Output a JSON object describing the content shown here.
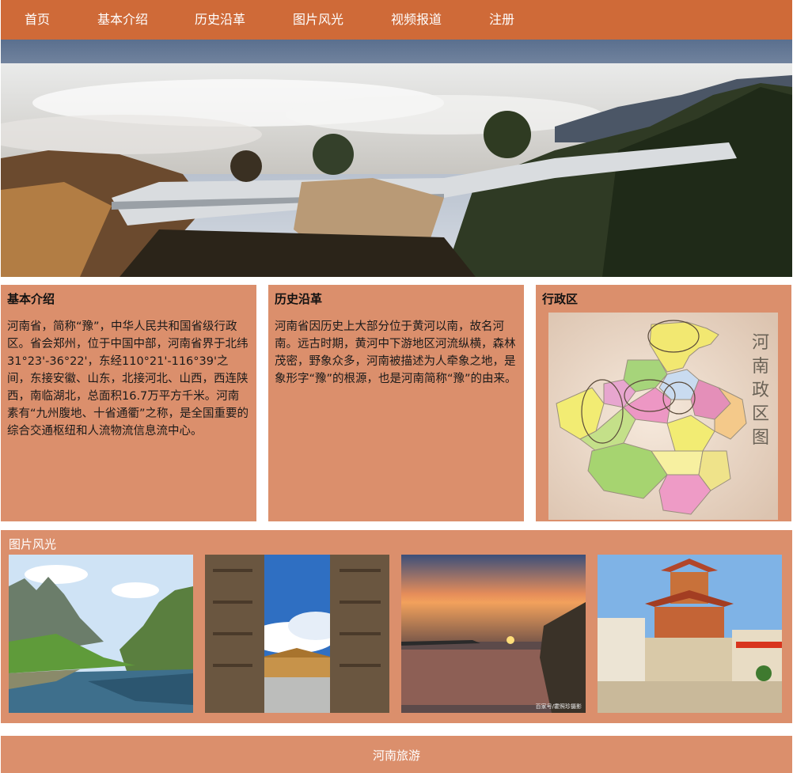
{
  "nav": {
    "items": [
      {
        "label": "首页"
      },
      {
        "label": "基本介绍"
      },
      {
        "label": "历史沿革"
      },
      {
        "label": "图片风光"
      },
      {
        "label": "视频报道"
      },
      {
        "label": "注册"
      }
    ]
  },
  "intro": {
    "title": "基本介绍",
    "text": "河南省，简称“豫”，中华人民共和国省级行政区。省会郑州，位于中国中部，河南省界于北纬31°23'-36°22'，东经110°21'-116°39'之间，东接安徽、山东，北接河北、山西，西连陕西，南临湖北，总面积16.7万平方千米。河南素有“九州腹地、十省通衢”之称，是全国重要的综合交通枢纽和人流物流信息流中心。"
  },
  "history": {
    "title": "历史沿革",
    "text": "河南省因历史上大部分位于黄河以南，故名河南。远古时期，黄河中下游地区河流纵横，森林茂密，野象众多，河南被描述为人牵象之地，是象形字“豫”的根源，也是河南简称“豫”的由来。"
  },
  "admin": {
    "title": "行政区",
    "map_caption": "河南政区图"
  },
  "gallery": {
    "title": "图片风光",
    "photo_watermark": "百家号/霍照珍摄影"
  },
  "footer": {
    "text": "河南旅游"
  },
  "colors": {
    "nav_bg": "#cf6a38",
    "panel_bg": "#db8f6c",
    "nav_text": "#ffffff"
  }
}
